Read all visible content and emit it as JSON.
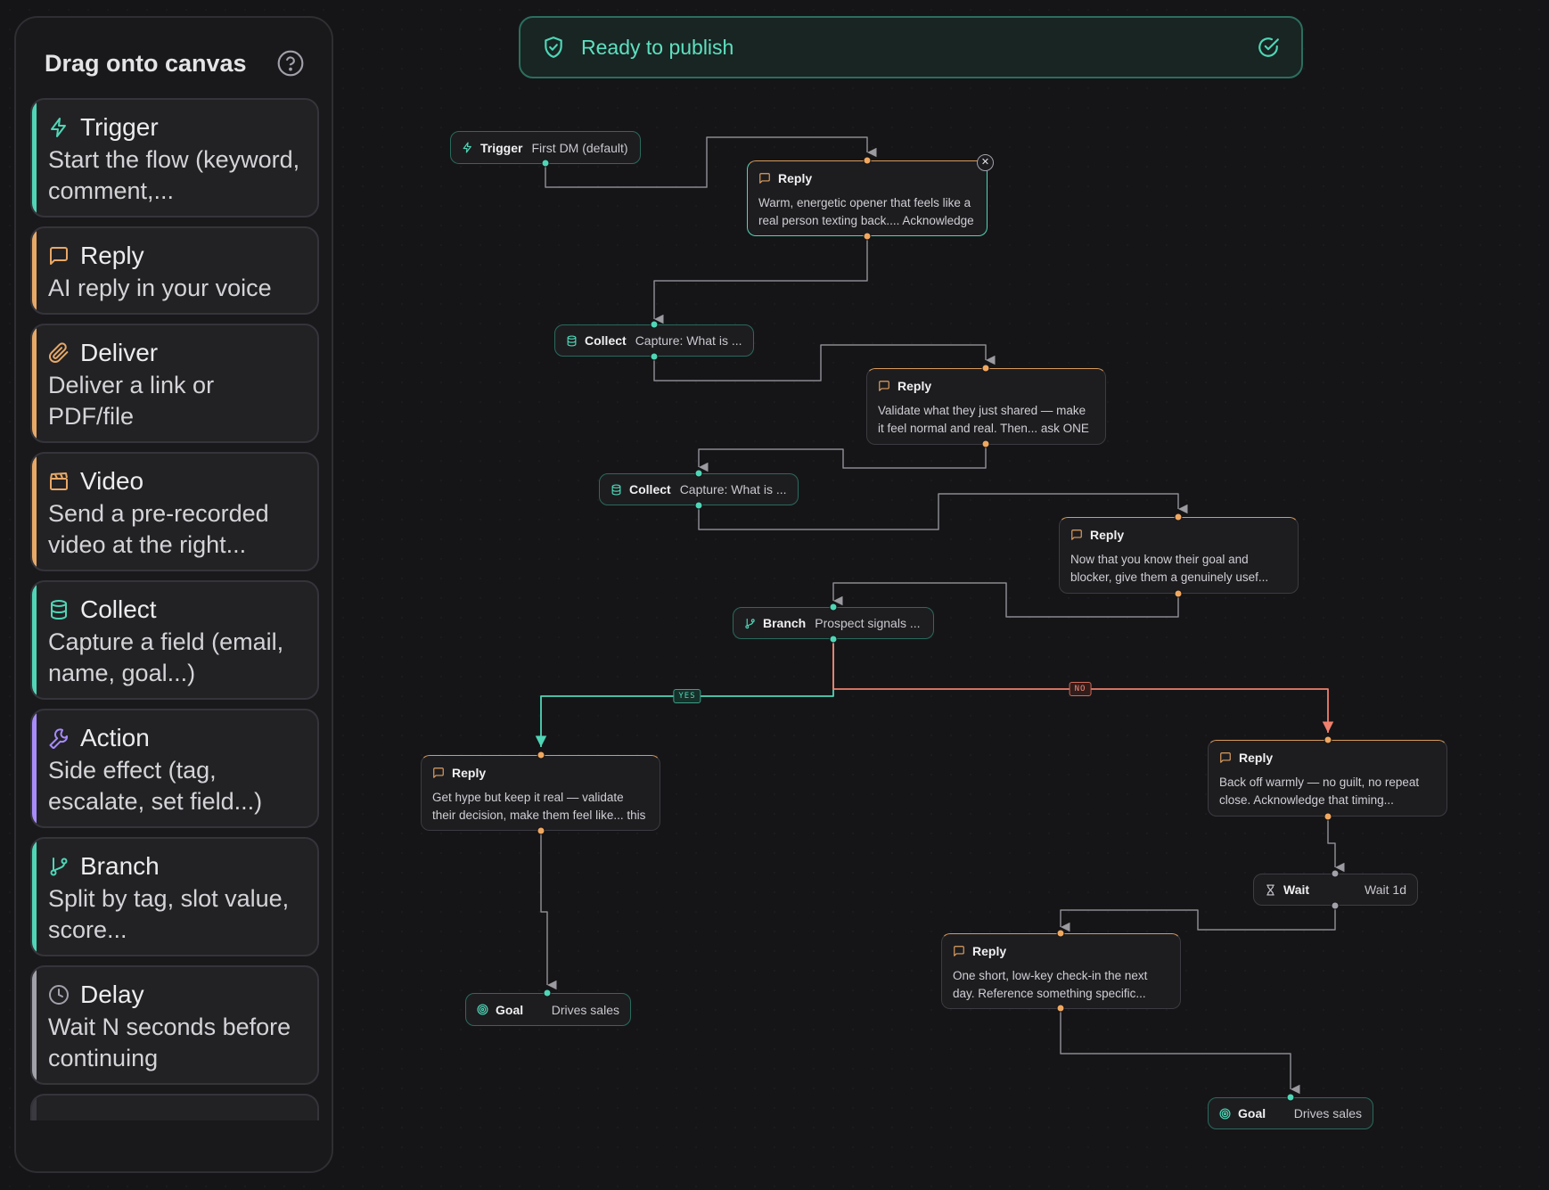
{
  "palette": {
    "title": "Drag onto canvas",
    "help_icon": "help-circle-icon",
    "blocks": [
      {
        "name": "Trigger",
        "desc": "Start the flow (keyword, comment,...",
        "icon": "lightning-icon",
        "color": "#4fd6b6"
      },
      {
        "name": "Reply",
        "desc": "AI reply in your voice",
        "icon": "message-square-icon",
        "color": "#e8a866"
      },
      {
        "name": "Deliver",
        "desc": "Deliver a link or PDF/file",
        "icon": "paperclip-icon",
        "color": "#e8a866"
      },
      {
        "name": "Video",
        "desc": "Send a pre-recorded video at the right...",
        "icon": "clapperboard-icon",
        "color": "#e8a866"
      },
      {
        "name": "Collect",
        "desc": "Capture a field (email, name, goal...)",
        "icon": "database-icon",
        "color": "#4fd6b6"
      },
      {
        "name": "Action",
        "desc": "Side effect (tag, escalate, set field...)",
        "icon": "wrench-icon",
        "color": "#a78bfa"
      },
      {
        "name": "Branch",
        "desc": "Split by tag, slot value, score...",
        "icon": "git-branch-icon",
        "color": "#4fd6b6"
      },
      {
        "name": "Delay",
        "desc": "Wait N seconds before continuing",
        "icon": "clock-icon",
        "color": "#a1a1aa"
      }
    ]
  },
  "banner": {
    "text": "Ready to publish",
    "icon": "shield-check-icon",
    "status_icon": "check-circle-icon"
  },
  "nodes": {
    "trigger": {
      "type": "Trigger",
      "text": "First DM (default)"
    },
    "reply1": {
      "type": "Reply",
      "text": "Warm, energetic opener that feels like a real person texting back.... Acknowledge them showing up"
    },
    "collect1": {
      "type": "Collect",
      "text": "Capture: What is ..."
    },
    "reply2": {
      "type": "Reply",
      "text": "Validate what they just shared — make it feel normal and real. Then... ask ONE follow-up question digging"
    },
    "collect2": {
      "type": "Collect",
      "text": "Capture: What is ..."
    },
    "reply3": {
      "type": "Reply",
      "text": "Now that you know their goal and blocker, give them a genuinely usef... honest answer or insight that"
    },
    "branch": {
      "type": "Branch",
      "text": "Prospect signals ..."
    },
    "reply_yes": {
      "type": "Reply",
      "text": "Get hype but keep it real — validate their decision, make them feel like... this is the right move. Then give them"
    },
    "goal1": {
      "type": "Goal",
      "text": "Drives sales"
    },
    "reply_no": {
      "type": "Reply",
      "text": "Back off warmly — no guilt, no repeat close. Acknowledge that timing... matters and it has to feel right for"
    },
    "wait": {
      "type": "Wait",
      "text": "Wait 1d"
    },
    "reply_followup": {
      "type": "Reply",
      "text": "One short, low-key check-in the next day. Reference something specific... they said earlier so it feels personal"
    },
    "goal2": {
      "type": "Goal",
      "text": "Drives sales"
    }
  },
  "edge_labels": {
    "yes": "YES",
    "no": "NO"
  },
  "colors": {
    "teal": "#4fd6b6",
    "orange": "#e8a866",
    "no_edge": "#f0806e",
    "edge": "#8a8a90"
  }
}
